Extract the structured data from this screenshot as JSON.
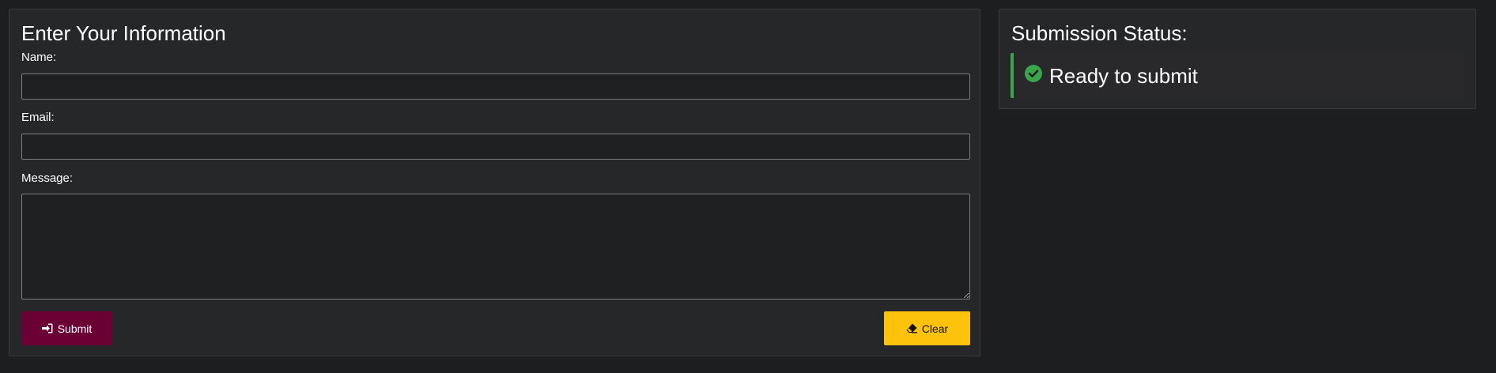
{
  "form": {
    "title": "Enter Your Information",
    "name_label": "Name:",
    "name_value": "",
    "email_label": "Email:",
    "email_value": "",
    "message_label": "Message:",
    "message_value": "",
    "submit_label": "Submit",
    "submit_icon": "sign-in-icon",
    "clear_label": "Clear",
    "clear_icon": "eraser-icon"
  },
  "status": {
    "title": "Submission Status:",
    "text": "Ready to submit",
    "icon": "check-circle-icon",
    "accent_color": "#3aa64a"
  },
  "colors": {
    "submit_button": "#6b0035",
    "clear_button": "#fdc20c",
    "background": "#1d1e20",
    "panel": "#262729"
  }
}
